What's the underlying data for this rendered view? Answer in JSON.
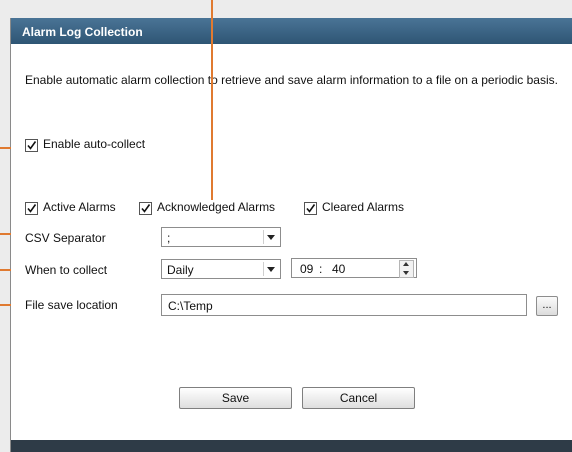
{
  "dialog": {
    "title": "Alarm Log Collection",
    "description": "Enable automatic alarm collection to retrieve and save alarm information to a file on a periodic basis."
  },
  "auto_collect": {
    "label": "Enable auto-collect",
    "checked": true
  },
  "alarm_types": [
    {
      "label": "Active Alarms",
      "checked": true
    },
    {
      "label": "Acknowledged Alarms",
      "checked": true
    },
    {
      "label": "Cleared Alarms",
      "checked": true
    }
  ],
  "csv_separator": {
    "label": "CSV Separator",
    "value": ";"
  },
  "when_to_collect": {
    "label": "When to collect",
    "frequency": "Daily",
    "time_hour": "09",
    "time_sep": ":",
    "time_minute": "40"
  },
  "file_save_location": {
    "label": "File save location",
    "value": "C:\\Temp",
    "browse_label": "..."
  },
  "buttons": {
    "save": "Save",
    "cancel": "Cancel"
  },
  "colors": {
    "title_bar": "#2e5574",
    "callout": "#e07a30",
    "bottom_bar": "#2e3b47"
  }
}
